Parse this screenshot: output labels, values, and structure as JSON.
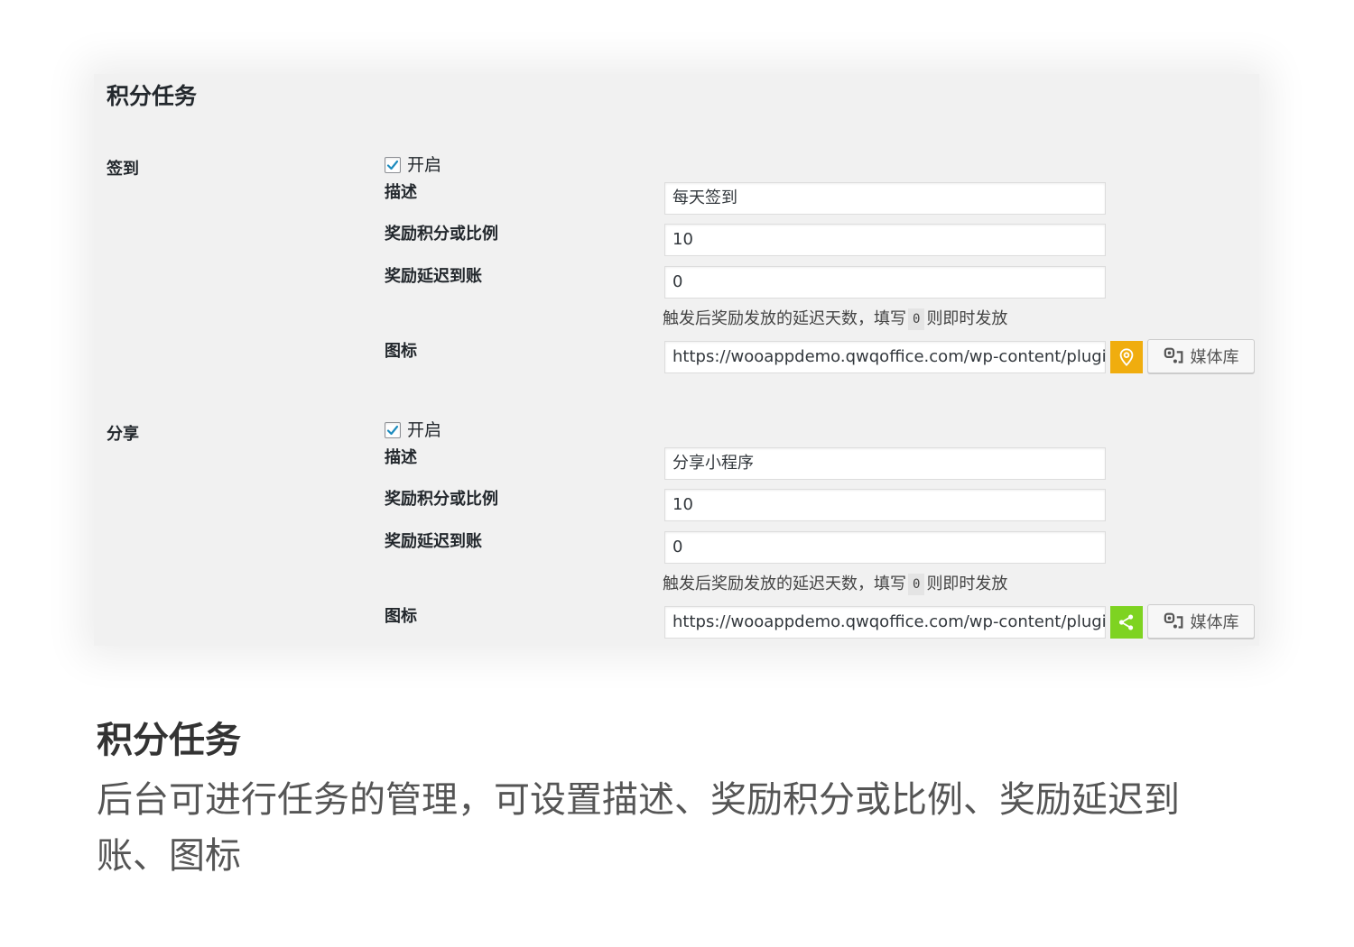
{
  "panel": {
    "title": "积分任务",
    "sections": [
      {
        "label": "签到",
        "enable_label": "开启",
        "enabled": true,
        "fields": {
          "description_label": "描述",
          "description_value": "每天签到",
          "reward_label": "奖励积分或比例",
          "reward_value": "10",
          "delay_label": "奖励延迟到账",
          "delay_value": "0",
          "hint_before": "触发后奖励发放的延迟天数，填写",
          "hint_code": "0",
          "hint_after": "则即时发放",
          "icon_label": "图标",
          "icon_url": "https://wooappdemo.qwqoffice.com/wp-content/plugi",
          "icon_preview": "location-pin-icon",
          "icon_color": "#f0ad0e",
          "media_button_label": "媒体库"
        }
      },
      {
        "label": "分享",
        "enable_label": "开启",
        "enabled": true,
        "fields": {
          "description_label": "描述",
          "description_value": "分享小程序",
          "reward_label": "奖励积分或比例",
          "reward_value": "10",
          "delay_label": "奖励延迟到账",
          "delay_value": "0",
          "hint_before": "触发后奖励发放的延迟天数，填写",
          "hint_code": "0",
          "hint_after": "则即时发放",
          "icon_label": "图标",
          "icon_url": "https://wooappdemo.qwqoffice.com/wp-content/plugi",
          "icon_preview": "share-icon",
          "icon_color": "#7ed321",
          "media_button_label": "媒体库"
        }
      }
    ]
  },
  "caption": {
    "title": "积分任务",
    "description": "后台可进行任务的管理，可设置描述、奖励积分或比例、奖励延迟到账、图标"
  }
}
